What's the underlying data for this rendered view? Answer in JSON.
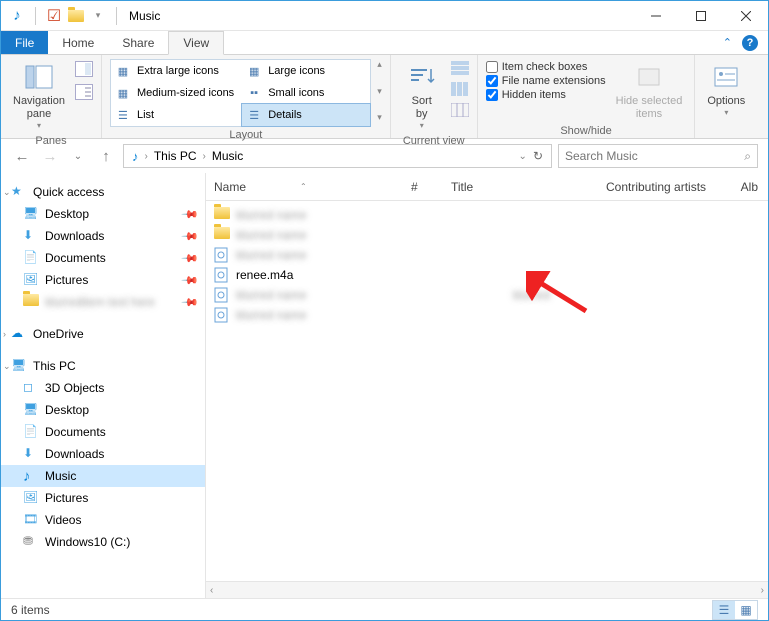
{
  "title": "Music",
  "ribbon_tabs": {
    "file": "File",
    "home": "Home",
    "share": "Share",
    "view": "View"
  },
  "ribbon": {
    "panes": {
      "nav_pane": "Navigation\npane",
      "label": "Panes"
    },
    "layout": {
      "extra_large": "Extra large icons",
      "large": "Large icons",
      "medium": "Medium-sized icons",
      "small": "Small icons",
      "list": "List",
      "details": "Details",
      "label": "Layout"
    },
    "current_view": {
      "sort_by": "Sort\nby",
      "label": "Current view"
    },
    "show_hide": {
      "check_boxes": "Item check boxes",
      "extensions": "File name extensions",
      "hidden": "Hidden items",
      "hide_selected": "Hide selected\nitems",
      "label": "Show/hide"
    },
    "options": "Options"
  },
  "breadcrumb": [
    "This PC",
    "Music"
  ],
  "search_placeholder": "Search Music",
  "nav": {
    "quick_access": "Quick access",
    "qa_items": [
      "Desktop",
      "Downloads",
      "Documents",
      "Pictures"
    ],
    "onedrive": "OneDrive",
    "this_pc": "This PC",
    "pc_items": [
      "3D Objects",
      "Desktop",
      "Documents",
      "Downloads",
      "Music",
      "Pictures",
      "Videos",
      "Windows10 (C:)"
    ]
  },
  "columns": {
    "name": "Name",
    "num": "#",
    "title": "Title",
    "contrib": "Contributing artists",
    "alb": "Alb"
  },
  "files": [
    {
      "name": "blurred",
      "type": "folder"
    },
    {
      "name": "blurred",
      "type": "folder"
    },
    {
      "name": "blurred",
      "type": "audio"
    },
    {
      "name": "renee.m4a",
      "type": "audio",
      "clear": true
    },
    {
      "name": "blurred",
      "type": "audio",
      "title_blur": true
    },
    {
      "name": "blurred",
      "type": "audio"
    }
  ],
  "status": "6 items"
}
